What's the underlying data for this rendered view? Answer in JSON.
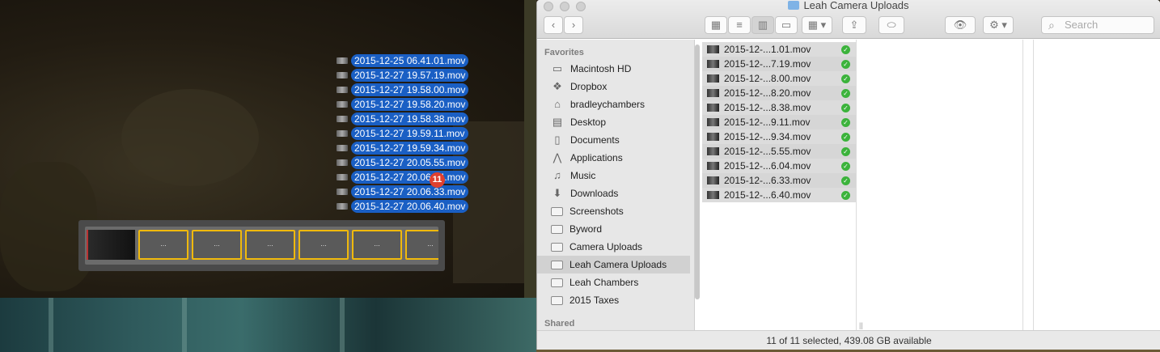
{
  "drag": {
    "files": [
      "2015-12-25 06.41.01.mov",
      "2015-12-27 19.57.19.mov",
      "2015-12-27 19.58.00.mov",
      "2015-12-27 19.58.20.mov",
      "2015-12-27 19.58.38.mov",
      "2015-12-27 19.59.11.mov",
      "2015-12-27 19.59.34.mov",
      "2015-12-27 20.05.55.mov",
      "2015-12-27 20.06.04.mov",
      "2015-12-27 20.06.33.mov",
      "2015-12-27 20.06.40.mov"
    ],
    "count_badge": "11",
    "slot_label": "..."
  },
  "finder": {
    "title": "Leah Camera Uploads",
    "search_placeholder": "Search",
    "sidebar": {
      "favorites_heading": "Favorites",
      "shared_heading": "Shared",
      "items": [
        {
          "label": "Macintosh HD",
          "icon": "hard-drive-icon"
        },
        {
          "label": "Dropbox",
          "icon": "dropbox-icon"
        },
        {
          "label": "bradleychambers",
          "icon": "home-icon"
        },
        {
          "label": "Desktop",
          "icon": "desktop-icon"
        },
        {
          "label": "Documents",
          "icon": "documents-icon"
        },
        {
          "label": "Applications",
          "icon": "applications-icon"
        },
        {
          "label": "Music",
          "icon": "music-icon"
        },
        {
          "label": "Downloads",
          "icon": "downloads-icon"
        },
        {
          "label": "Screenshots",
          "icon": "folder-icon"
        },
        {
          "label": "Byword",
          "icon": "folder-icon"
        },
        {
          "label": "Camera Uploads",
          "icon": "folder-icon"
        },
        {
          "label": "Leah Camera Uploads",
          "icon": "folder-icon",
          "selected": true
        },
        {
          "label": "Leah Chambers",
          "icon": "folder-icon"
        },
        {
          "label": "2015 Taxes",
          "icon": "folder-icon"
        }
      ]
    },
    "files": [
      "2015-12-...1.01.mov",
      "2015-12-...7.19.mov",
      "2015-12-...8.00.mov",
      "2015-12-...8.20.mov",
      "2015-12-...8.38.mov",
      "2015-12-...9.11.mov",
      "2015-12-...9.34.mov",
      "2015-12-...5.55.mov",
      "2015-12-...6.04.mov",
      "2015-12-...6.33.mov",
      "2015-12-...6.40.mov"
    ],
    "status": "11 of 11 selected, 439.08 GB available",
    "colors": {
      "selection_blue": "#1a5fc4",
      "sync_green": "#3bb33b",
      "badge_red": "#e0402f",
      "slot_yellow": "#f0b90c"
    }
  }
}
